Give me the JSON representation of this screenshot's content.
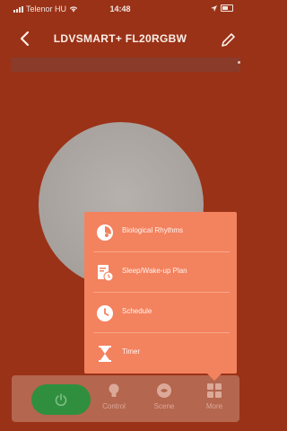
{
  "status_bar": {
    "carrier": "Telenor HU",
    "time": "14:48"
  },
  "nav": {
    "title": "LDVSMART+ FL20RGBW"
  },
  "popup_menu": {
    "items": [
      {
        "label": "Biological Rhythms",
        "icon": "biological-rhythms-icon"
      },
      {
        "label": "Sleep/Wake-up Plan",
        "icon": "sleep-plan-icon"
      },
      {
        "label": "Schedule",
        "icon": "clock-icon"
      },
      {
        "label": "Timer",
        "icon": "hourglass-icon"
      }
    ]
  },
  "bottom_bar": {
    "control_label": "Control",
    "scene_label": "Scene",
    "more_label": "More"
  },
  "colors": {
    "background": "#9a3217",
    "popup": "#f3825e",
    "power_button": "#2f8f3e",
    "wheel": "#a7a19d"
  }
}
